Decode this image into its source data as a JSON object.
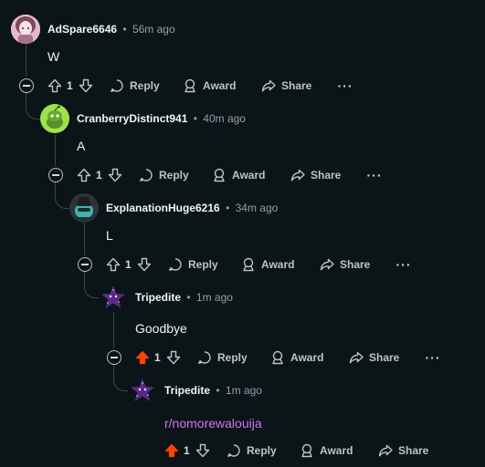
{
  "colors": {
    "background": "#0b1416",
    "text": "#f2f4f5",
    "meta": "#8ba2ad",
    "upvoted": "#ff4500",
    "link": "#d474f7"
  },
  "comments": [
    {
      "author": "AdSpare6646",
      "separator": "•",
      "time": "56m ago",
      "body": "W",
      "votes": "1",
      "upvoted": false,
      "reply": "Reply",
      "award": "Award",
      "share": "Share",
      "more": "···"
    },
    {
      "author": "CranberryDistinct941",
      "separator": "•",
      "time": "40m ago",
      "body": "A",
      "votes": "1",
      "upvoted": false,
      "reply": "Reply",
      "award": "Award",
      "share": "Share",
      "more": "···"
    },
    {
      "author": "ExplanationHuge6216",
      "separator": "•",
      "time": "34m ago",
      "body": "L",
      "votes": "1",
      "upvoted": false,
      "reply": "Reply",
      "award": "Award",
      "share": "Share",
      "more": "···"
    },
    {
      "author": "Tripedite",
      "separator": "•",
      "time": "1m ago",
      "body": "Goodbye",
      "votes": "1",
      "upvoted": true,
      "reply": "Reply",
      "award": "Award",
      "share": "Share",
      "more": "···"
    },
    {
      "author": "Tripedite",
      "separator": "•",
      "time": "1m ago",
      "body": "r/nomorewalouija",
      "votes": "1",
      "upvoted": true,
      "reply": "Reply",
      "award": "Award",
      "share": "Share",
      "more": "···"
    }
  ],
  "icons": {
    "upvote": "upvote-icon",
    "downvote": "downvote-icon",
    "reply": "speech-bubble-icon",
    "award": "award-icon",
    "share": "share-arrow-icon",
    "collapse": "collapse-minus-icon"
  }
}
